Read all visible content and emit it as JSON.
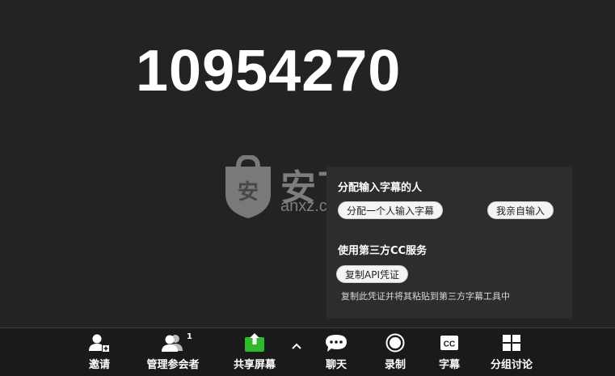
{
  "meeting": {
    "id_display": "10954270"
  },
  "watermark": {
    "text_cn": "安下载",
    "text_en": "anxz.com",
    "shield_char": "安"
  },
  "caption_panel": {
    "assign_heading": "分配输入字幕的人",
    "assign_person_button": "分配一个人输入字幕",
    "self_type_button": "我亲自输入",
    "third_party_heading": "使用第三方CC服务",
    "copy_api_button": "复制API凭证",
    "copy_api_hint": "复制此凭证并将其粘贴到第三方字幕工具中"
  },
  "toolbar": {
    "invite_label": "邀请",
    "participants_label": "管理参会者",
    "participants_count": "1",
    "share_label": "共享屏幕",
    "chat_label": "聊天",
    "record_label": "录制",
    "cc_label": "字幕",
    "cc_icon_text": "CC",
    "breakout_label": "分组讨论"
  },
  "colors": {
    "share_green": "#2dbb2d",
    "panel_bg": "#2d2d30",
    "toolbar_bg": "#1a1a1a",
    "video_bg": "#232224"
  }
}
